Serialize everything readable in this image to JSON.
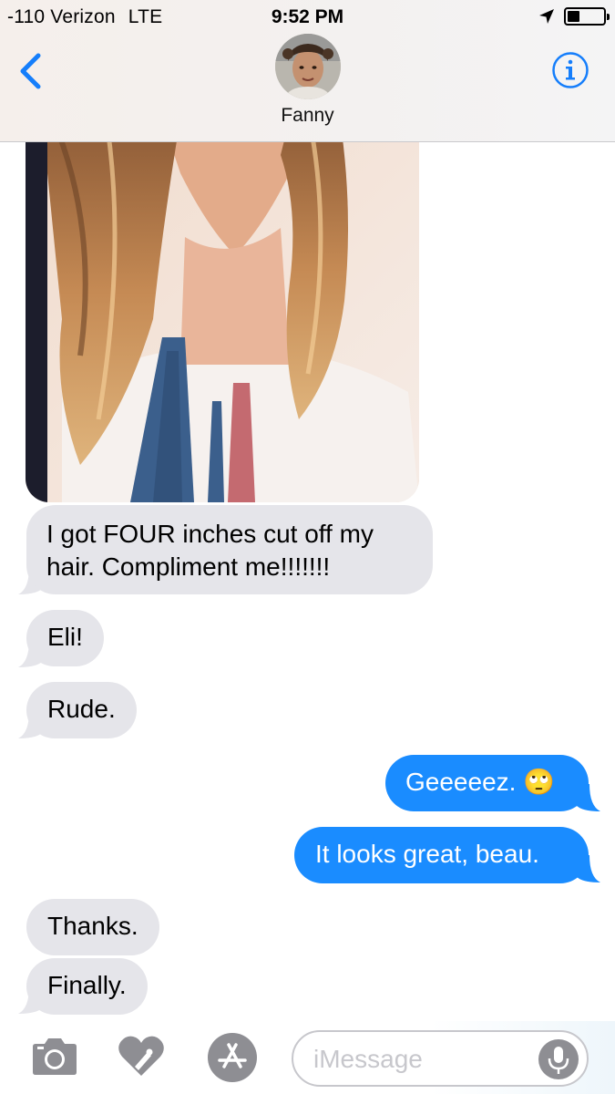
{
  "status_bar": {
    "carrier": "-110 Verizon",
    "network": "LTE",
    "time": "9:52 PM",
    "battery_level": 0.35
  },
  "header": {
    "contact_name": "Fanny",
    "icons": {
      "back": "chevron-left-icon",
      "info": "info-icon",
      "location": "location-arrow-icon",
      "battery": "battery-icon"
    }
  },
  "messages": [
    {
      "direction": "incoming",
      "type": "photo"
    },
    {
      "direction": "incoming",
      "text": "I got FOUR inches cut off my hair. Compliment me!!!!!!!"
    },
    {
      "direction": "incoming",
      "text": "Eli!"
    },
    {
      "direction": "incoming",
      "text": "Rude."
    },
    {
      "direction": "outgoing",
      "text": "Geeeeez. 🙄"
    },
    {
      "direction": "outgoing",
      "text": "It looks great, beau."
    },
    {
      "direction": "incoming",
      "text": "Thanks."
    },
    {
      "direction": "incoming",
      "text": "Finally."
    }
  ],
  "compose": {
    "placeholder": "iMessage",
    "icons": [
      "camera-icon",
      "digital-touch-heart-icon",
      "app-store-icon",
      "microphone-icon"
    ]
  },
  "colors": {
    "outgoing_bubble": "#1a8cff",
    "incoming_bubble": "#e5e5ea",
    "ios_blue": "#157efb"
  }
}
